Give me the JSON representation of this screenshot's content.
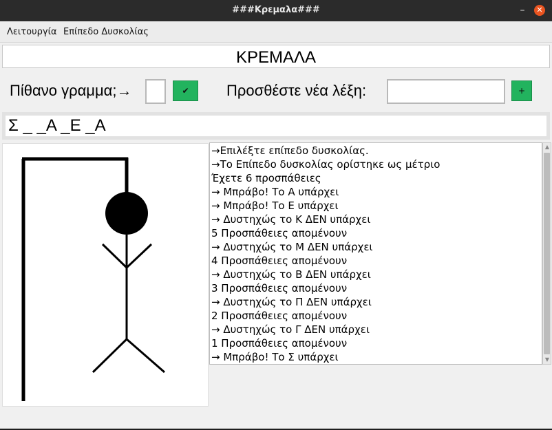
{
  "window": {
    "title": "###Κρεμαλα###",
    "minimize": "–",
    "close": "✕"
  },
  "menu": {
    "items": [
      "Λειτουργία",
      "Επίπεδο Δυσκολίας"
    ]
  },
  "heading": "ΚΡΕΜΑΛΑ",
  "guess": {
    "label": "Πίθανο γραμμα;→",
    "value": "",
    "submit_icon": "✔"
  },
  "add_word": {
    "label": "Προσθέστε νέα λέξη:",
    "value": "",
    "add_icon": "+"
  },
  "word_display": "Σ _ _Α _Ε _Α",
  "log": [
    "→Επιλέξτε επίπεδο δυσκολίας.",
    "→Το Επίπεδο δυσκολίας ορίστηκε ως μέτριο",
    " Έχετε 6 προσπάθειες",
    "→ Μπράβο! Το Α υπάρχει",
    "→ Μπράβο! Το Ε υπάρχει",
    "→ Δυστηχώς το Κ ΔΕΝ υπάρχει",
    "5 Προσπάθειες απομένουν",
    "→ Δυστηχώς το Μ ΔΕΝ υπάρχει",
    "4 Προσπάθειες απομένουν",
    "→ Δυστηχώς το Β ΔΕΝ υπάρχει",
    "3 Προσπάθειες απομένουν",
    "→ Δυστηχώς το Π ΔΕΝ υπάρχει",
    "2 Προσπάθειες απομένουν",
    "→ Δυστηχώς το Γ ΔΕΝ υπάρχει",
    "1 Προσπάθειες απομένουν",
    "→ Μπράβο! Το Σ υπάρχει"
  ],
  "colors": {
    "accent_button": "#22b35e",
    "close_button": "#e95420",
    "titlebar": "#2b2b2b"
  },
  "icons": {
    "submit": "checkmark-icon",
    "add": "plus-icon"
  }
}
